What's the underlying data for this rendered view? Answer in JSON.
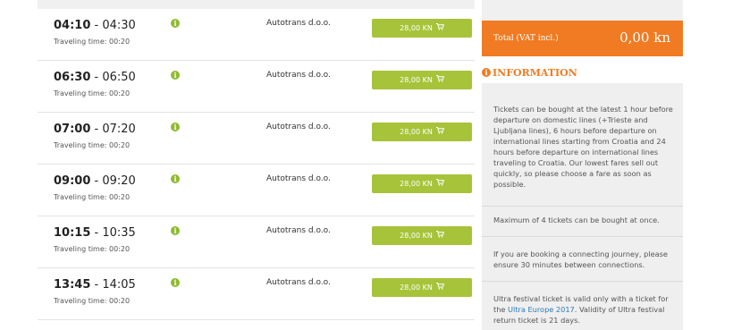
{
  "results": [
    {
      "departure": "04:10",
      "arrival": "04:30",
      "travel_time": "Traveling time: 00:20",
      "carrier": "Autotrans d.o.o.",
      "price": "28,00 KN"
    },
    {
      "departure": "06:30",
      "arrival": "06:50",
      "travel_time": "Traveling time: 00:20",
      "carrier": "Autotrans d.o.o.",
      "price": "28,00 KN"
    },
    {
      "departure": "07:00",
      "arrival": "07:20",
      "travel_time": "Traveling time: 00:20",
      "carrier": "Autotrans d.o.o.",
      "price": "28,00 KN"
    },
    {
      "departure": "09:00",
      "arrival": "09:20",
      "travel_time": "Traveling time: 00:20",
      "carrier": "Autotrans d.o.o.",
      "price": "28,00 KN"
    },
    {
      "departure": "10:15",
      "arrival": "10:35",
      "travel_time": "Traveling time: 00:20",
      "carrier": "Autotrans d.o.o.",
      "price": "28,00 KN"
    },
    {
      "departure": "13:45",
      "arrival": "14:05",
      "travel_time": "Traveling time: 00:20",
      "carrier": "Autotrans d.o.o.",
      "price": "28,00 KN"
    }
  ],
  "time_separator": "-",
  "row_icons": {
    "info": "info-circle-icon",
    "cart": "shopping-cart-icon"
  },
  "sidebar": {
    "total_label": "Total (VAT incl.)",
    "total_value": "0,00 kn",
    "info_title": "INFORMATION",
    "info_icon": "info-circle-icon",
    "paragraphs": {
      "p1": "Tickets can be bought at the latest 1 hour before departure on domestic lines (+Trieste and Ljubljana lines), 6 hours before departure on international lines starting from Croatia and 24 hours before departure on international lines traveling to Croatia. Our lowest fares sell out quickly, so please choose a fare as soon as possible.",
      "p2": "Maximum of 4 tickets can be bought at once.",
      "p3": "If you are booking a connecting journey, please ensure 30 minutes between connections.",
      "p4_before": "Ultra festival ticket is valid only with a ticket for the ",
      "p4_link": "Ultra Europe 2017",
      "p4_after": ". Validity of Ultra festival return ticket is 21 days."
    }
  },
  "colors": {
    "accent_orange": "#f07b22",
    "button_green": "#a7c339",
    "icon_green": "#8dbb2e",
    "link_blue": "#2b7bb9"
  }
}
